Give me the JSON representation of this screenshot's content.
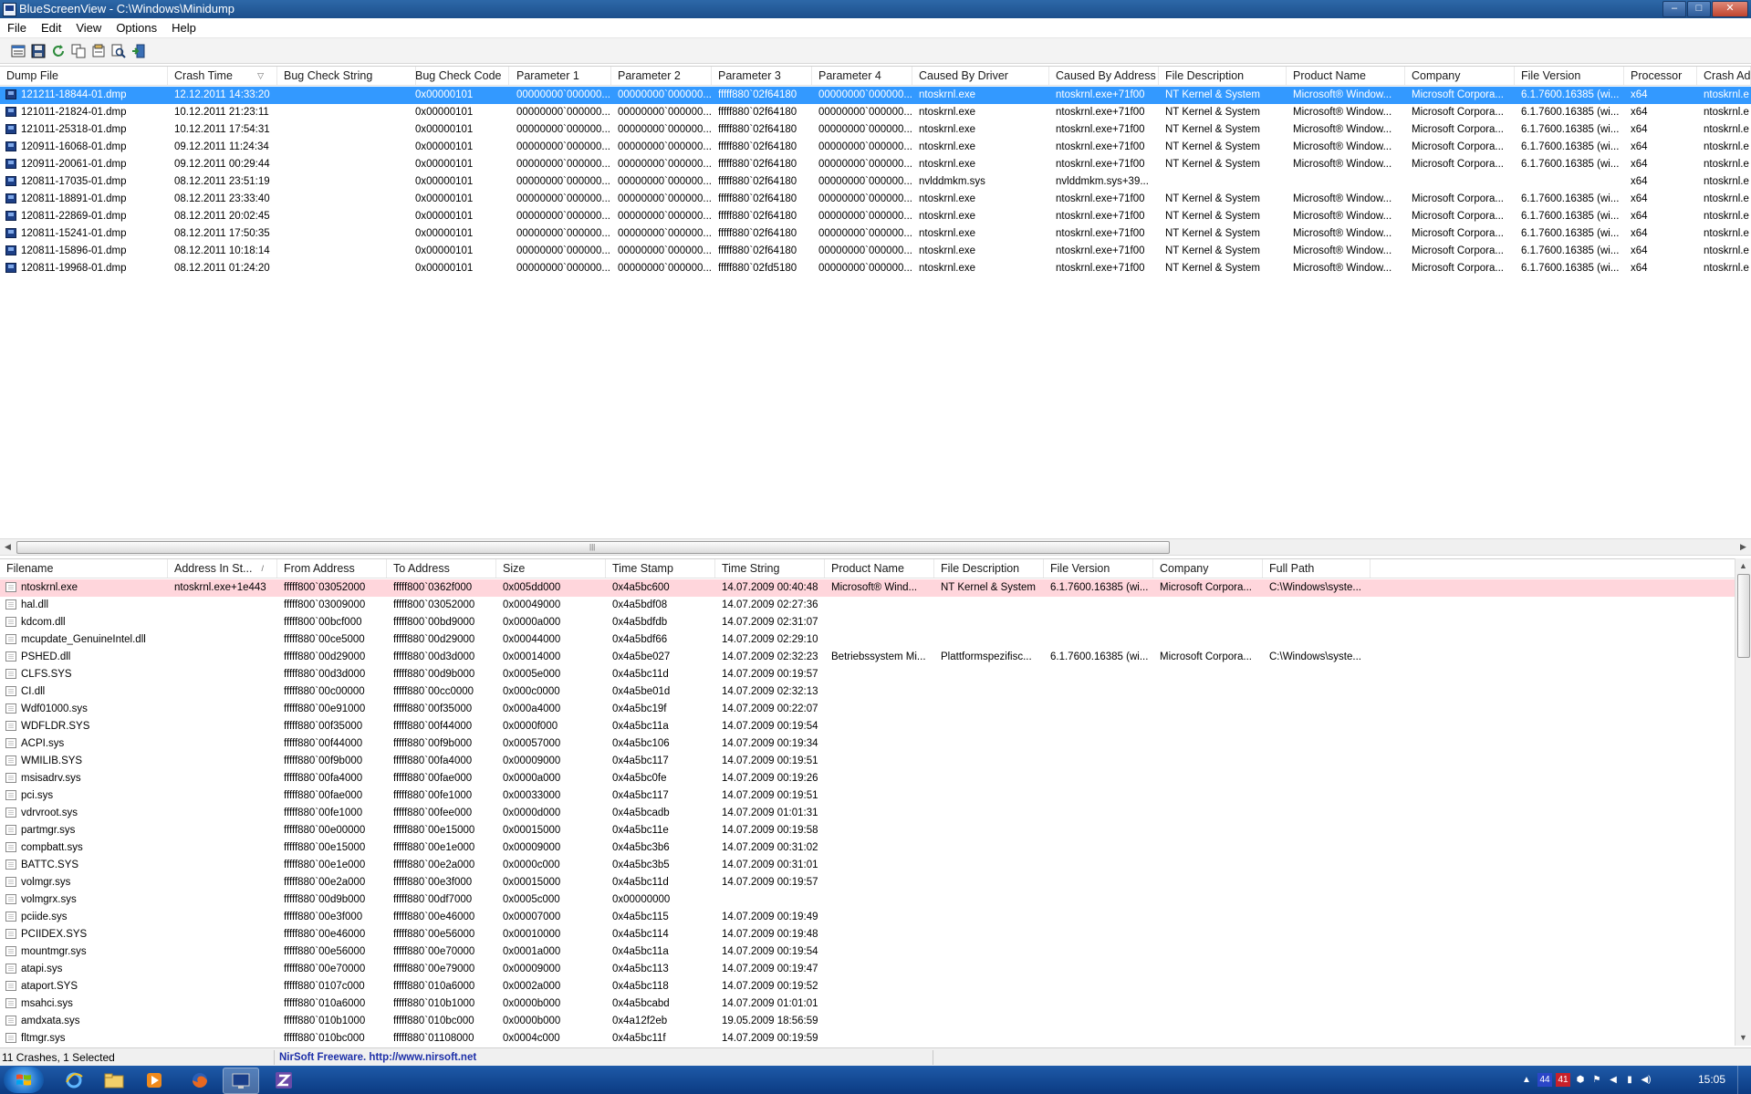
{
  "window": {
    "title": "BlueScreenView  -  C:\\Windows\\Minidump",
    "minimize_label": "–",
    "maximize_label": "□",
    "close_label": "✕"
  },
  "menu": [
    "File",
    "Edit",
    "View",
    "Options",
    "Help"
  ],
  "toolbar": {
    "icons": [
      "properties-icon",
      "save-icon",
      "refresh-icon",
      "copy-icon",
      "html-report-icon",
      "find-icon",
      "exit-icon"
    ]
  },
  "crash_list": {
    "columns": [
      "Dump File",
      "Crash Time",
      "Bug Check String",
      "Bug Check Code",
      "Parameter 1",
      "Parameter 2",
      "Parameter 3",
      "Parameter 4",
      "Caused By Driver",
      "Caused By Address",
      "File Description",
      "Product Name",
      "Company",
      "File Version",
      "Processor",
      "Crash Add"
    ],
    "sorted_column": "Crash Time",
    "sort_arrow": "▽",
    "selected_index": 0,
    "rows": [
      [
        "121211-18844-01.dmp",
        "12.12.2011 14:33:20",
        "",
        "0x00000101",
        "00000000`000000...",
        "00000000`000000...",
        "fffff880`02f64180",
        "00000000`000000...",
        "ntoskrnl.exe",
        "ntoskrnl.exe+71f00",
        "NT Kernel & System",
        "Microsoft® Window...",
        "Microsoft Corpora...",
        "6.1.7600.16385 (wi...",
        "x64",
        "ntoskrnl.e"
      ],
      [
        "121011-21824-01.dmp",
        "10.12.2011 21:23:11",
        "",
        "0x00000101",
        "00000000`000000...",
        "00000000`000000...",
        "fffff880`02f64180",
        "00000000`000000...",
        "ntoskrnl.exe",
        "ntoskrnl.exe+71f00",
        "NT Kernel & System",
        "Microsoft® Window...",
        "Microsoft Corpora...",
        "6.1.7600.16385 (wi...",
        "x64",
        "ntoskrnl.e"
      ],
      [
        "121011-25318-01.dmp",
        "10.12.2011 17:54:31",
        "",
        "0x00000101",
        "00000000`000000...",
        "00000000`000000...",
        "fffff880`02f64180",
        "00000000`000000...",
        "ntoskrnl.exe",
        "ntoskrnl.exe+71f00",
        "NT Kernel & System",
        "Microsoft® Window...",
        "Microsoft Corpora...",
        "6.1.7600.16385 (wi...",
        "x64",
        "ntoskrnl.e"
      ],
      [
        "120911-16068-01.dmp",
        "09.12.2011 11:24:34",
        "",
        "0x00000101",
        "00000000`000000...",
        "00000000`000000...",
        "fffff880`02f64180",
        "00000000`000000...",
        "ntoskrnl.exe",
        "ntoskrnl.exe+71f00",
        "NT Kernel & System",
        "Microsoft® Window...",
        "Microsoft Corpora...",
        "6.1.7600.16385 (wi...",
        "x64",
        "ntoskrnl.e"
      ],
      [
        "120911-20061-01.dmp",
        "09.12.2011 00:29:44",
        "",
        "0x00000101",
        "00000000`000000...",
        "00000000`000000...",
        "fffff880`02f64180",
        "00000000`000000...",
        "ntoskrnl.exe",
        "ntoskrnl.exe+71f00",
        "NT Kernel & System",
        "Microsoft® Window...",
        "Microsoft Corpora...",
        "6.1.7600.16385 (wi...",
        "x64",
        "ntoskrnl.e"
      ],
      [
        "120811-17035-01.dmp",
        "08.12.2011 23:51:19",
        "",
        "0x00000101",
        "00000000`000000...",
        "00000000`000000...",
        "fffff880`02f64180",
        "00000000`000000...",
        "nvlddmkm.sys",
        "nvlddmkm.sys+39...",
        "",
        "",
        "",
        "",
        "x64",
        "ntoskrnl.e"
      ],
      [
        "120811-18891-01.dmp",
        "08.12.2011 23:33:40",
        "",
        "0x00000101",
        "00000000`000000...",
        "00000000`000000...",
        "fffff880`02f64180",
        "00000000`000000...",
        "ntoskrnl.exe",
        "ntoskrnl.exe+71f00",
        "NT Kernel & System",
        "Microsoft® Window...",
        "Microsoft Corpora...",
        "6.1.7600.16385 (wi...",
        "x64",
        "ntoskrnl.e"
      ],
      [
        "120811-22869-01.dmp",
        "08.12.2011 20:02:45",
        "",
        "0x00000101",
        "00000000`000000...",
        "00000000`000000...",
        "fffff880`02f64180",
        "00000000`000000...",
        "ntoskrnl.exe",
        "ntoskrnl.exe+71f00",
        "NT Kernel & System",
        "Microsoft® Window...",
        "Microsoft Corpora...",
        "6.1.7600.16385 (wi...",
        "x64",
        "ntoskrnl.e"
      ],
      [
        "120811-15241-01.dmp",
        "08.12.2011 17:50:35",
        "",
        "0x00000101",
        "00000000`000000...",
        "00000000`000000...",
        "fffff880`02f64180",
        "00000000`000000...",
        "ntoskrnl.exe",
        "ntoskrnl.exe+71f00",
        "NT Kernel & System",
        "Microsoft® Window...",
        "Microsoft Corpora...",
        "6.1.7600.16385 (wi...",
        "x64",
        "ntoskrnl.e"
      ],
      [
        "120811-15896-01.dmp",
        "08.12.2011 10:18:14",
        "",
        "0x00000101",
        "00000000`000000...",
        "00000000`000000...",
        "fffff880`02f64180",
        "00000000`000000...",
        "ntoskrnl.exe",
        "ntoskrnl.exe+71f00",
        "NT Kernel & System",
        "Microsoft® Window...",
        "Microsoft Corpora...",
        "6.1.7600.16385 (wi...",
        "x64",
        "ntoskrnl.e"
      ],
      [
        "120811-19968-01.dmp",
        "08.12.2011 01:24:20",
        "",
        "0x00000101",
        "00000000`000000...",
        "00000000`000000...",
        "fffff880`02fd5180",
        "00000000`000000...",
        "ntoskrnl.exe",
        "ntoskrnl.exe+71f00",
        "NT Kernel & System",
        "Microsoft® Window...",
        "Microsoft Corpora...",
        "6.1.7600.16385 (wi...",
        "x64",
        "ntoskrnl.e"
      ]
    ]
  },
  "driver_list": {
    "columns": [
      "Filename",
      "Address In St...",
      "From Address",
      "To Address",
      "Size",
      "Time Stamp",
      "Time String",
      "Product Name",
      "File Description",
      "File Version",
      "Company",
      "Full Path"
    ],
    "sorted_column": "Address In St...",
    "sort_arrow": "/",
    "highlighted_index": 0,
    "rows": [
      [
        "ntoskrnl.exe",
        "ntoskrnl.exe+1e443",
        "fffff800`03052000",
        "fffff800`0362f000",
        "0x005dd000",
        "0x4a5bc600",
        "14.07.2009 00:40:48",
        "Microsoft® Wind...",
        "NT Kernel & System",
        "6.1.7600.16385 (wi...",
        "Microsoft Corpora...",
        "C:\\Windows\\syste..."
      ],
      [
        "hal.dll",
        "",
        "fffff800`03009000",
        "fffff800`03052000",
        "0x00049000",
        "0x4a5bdf08",
        "14.07.2009 02:27:36",
        "",
        "",
        "",
        "",
        ""
      ],
      [
        "kdcom.dll",
        "",
        "fffff800`00bcf000",
        "fffff800`00bd9000",
        "0x0000a000",
        "0x4a5bdfdb",
        "14.07.2009 02:31:07",
        "",
        "",
        "",
        "",
        ""
      ],
      [
        "mcupdate_GenuineIntel.dll",
        "",
        "fffff880`00ce5000",
        "fffff880`00d29000",
        "0x00044000",
        "0x4a5bdf66",
        "14.07.2009 02:29:10",
        "",
        "",
        "",
        "",
        ""
      ],
      [
        "PSHED.dll",
        "",
        "fffff880`00d29000",
        "fffff880`00d3d000",
        "0x00014000",
        "0x4a5be027",
        "14.07.2009 02:32:23",
        "Betriebssystem Mi...",
        "Plattformspezifisc...",
        "6.1.7600.16385 (wi...",
        "Microsoft Corpora...",
        "C:\\Windows\\syste..."
      ],
      [
        "CLFS.SYS",
        "",
        "fffff880`00d3d000",
        "fffff880`00d9b000",
        "0x0005e000",
        "0x4a5bc11d",
        "14.07.2009 00:19:57",
        "",
        "",
        "",
        "",
        ""
      ],
      [
        "CI.dll",
        "",
        "fffff880`00c00000",
        "fffff880`00cc0000",
        "0x000c0000",
        "0x4a5be01d",
        "14.07.2009 02:32:13",
        "",
        "",
        "",
        "",
        ""
      ],
      [
        "Wdf01000.sys",
        "",
        "fffff880`00e91000",
        "fffff880`00f35000",
        "0x000a4000",
        "0x4a5bc19f",
        "14.07.2009 00:22:07",
        "",
        "",
        "",
        "",
        ""
      ],
      [
        "WDFLDR.SYS",
        "",
        "fffff880`00f35000",
        "fffff880`00f44000",
        "0x0000f000",
        "0x4a5bc11a",
        "14.07.2009 00:19:54",
        "",
        "",
        "",
        "",
        ""
      ],
      [
        "ACPI.sys",
        "",
        "fffff880`00f44000",
        "fffff880`00f9b000",
        "0x00057000",
        "0x4a5bc106",
        "14.07.2009 00:19:34",
        "",
        "",
        "",
        "",
        ""
      ],
      [
        "WMILIB.SYS",
        "",
        "fffff880`00f9b000",
        "fffff880`00fa4000",
        "0x00009000",
        "0x4a5bc117",
        "14.07.2009 00:19:51",
        "",
        "",
        "",
        "",
        ""
      ],
      [
        "msisadrv.sys",
        "",
        "fffff880`00fa4000",
        "fffff880`00fae000",
        "0x0000a000",
        "0x4a5bc0fe",
        "14.07.2009 00:19:26",
        "",
        "",
        "",
        "",
        ""
      ],
      [
        "pci.sys",
        "",
        "fffff880`00fae000",
        "fffff880`00fe1000",
        "0x00033000",
        "0x4a5bc117",
        "14.07.2009 00:19:51",
        "",
        "",
        "",
        "",
        ""
      ],
      [
        "vdrvroot.sys",
        "",
        "fffff880`00fe1000",
        "fffff880`00fee000",
        "0x0000d000",
        "0x4a5bcadb",
        "14.07.2009 01:01:31",
        "",
        "",
        "",
        "",
        ""
      ],
      [
        "partmgr.sys",
        "",
        "fffff880`00e00000",
        "fffff880`00e15000",
        "0x00015000",
        "0x4a5bc11e",
        "14.07.2009 00:19:58",
        "",
        "",
        "",
        "",
        ""
      ],
      [
        "compbatt.sys",
        "",
        "fffff880`00e15000",
        "fffff880`00e1e000",
        "0x00009000",
        "0x4a5bc3b6",
        "14.07.2009 00:31:02",
        "",
        "",
        "",
        "",
        ""
      ],
      [
        "BATTC.SYS",
        "",
        "fffff880`00e1e000",
        "fffff880`00e2a000",
        "0x0000c000",
        "0x4a5bc3b5",
        "14.07.2009 00:31:01",
        "",
        "",
        "",
        "",
        ""
      ],
      [
        "volmgr.sys",
        "",
        "fffff880`00e2a000",
        "fffff880`00e3f000",
        "0x00015000",
        "0x4a5bc11d",
        "14.07.2009 00:19:57",
        "",
        "",
        "",
        "",
        ""
      ],
      [
        "volmgrx.sys",
        "",
        "fffff880`00d9b000",
        "fffff880`00df7000",
        "0x0005c000",
        "0x00000000",
        "",
        "",
        "",
        "",
        "",
        ""
      ],
      [
        "pciide.sys",
        "",
        "fffff880`00e3f000",
        "fffff880`00e46000",
        "0x00007000",
        "0x4a5bc115",
        "14.07.2009 00:19:49",
        "",
        "",
        "",
        "",
        ""
      ],
      [
        "PCIIDEX.SYS",
        "",
        "fffff880`00e46000",
        "fffff880`00e56000",
        "0x00010000",
        "0x4a5bc114",
        "14.07.2009 00:19:48",
        "",
        "",
        "",
        "",
        ""
      ],
      [
        "mountmgr.sys",
        "",
        "fffff880`00e56000",
        "fffff880`00e70000",
        "0x0001a000",
        "0x4a5bc11a",
        "14.07.2009 00:19:54",
        "",
        "",
        "",
        "",
        ""
      ],
      [
        "atapi.sys",
        "",
        "fffff880`00e70000",
        "fffff880`00e79000",
        "0x00009000",
        "0x4a5bc113",
        "14.07.2009 00:19:47",
        "",
        "",
        "",
        "",
        ""
      ],
      [
        "ataport.SYS",
        "",
        "fffff880`0107c000",
        "fffff880`010a6000",
        "0x0002a000",
        "0x4a5bc118",
        "14.07.2009 00:19:52",
        "",
        "",
        "",
        "",
        ""
      ],
      [
        "msahci.sys",
        "",
        "fffff880`010a6000",
        "fffff880`010b1000",
        "0x0000b000",
        "0x4a5bcabd",
        "14.07.2009 01:01:01",
        "",
        "",
        "",
        "",
        ""
      ],
      [
        "amdxata.sys",
        "",
        "fffff880`010b1000",
        "fffff880`010bc000",
        "0x0000b000",
        "0x4a12f2eb",
        "19.05.2009 18:56:59",
        "",
        "",
        "",
        "",
        ""
      ],
      [
        "fltmgr.sys",
        "",
        "fffff880`010bc000",
        "fffff880`01108000",
        "0x0004c000",
        "0x4a5bc11f",
        "14.07.2009 00:19:59",
        "",
        "",
        "",
        "",
        ""
      ]
    ]
  },
  "status": {
    "count_text": "11 Crashes, 1 Selected",
    "freeware_text": "NirSoft Freeware.  http://www.nirsoft.net"
  },
  "taskbar": {
    "apps": [
      "ie-icon",
      "explorer-icon",
      "media-player-icon",
      "firefox-icon",
      "bluescreenview-icon",
      "zonealarm-icon"
    ],
    "tray_badge_blue": "44",
    "tray_badge_red": "41",
    "clock": "15:05"
  },
  "colors": {
    "selection": "#3399ff",
    "highlight_row": "#ffd6dc",
    "taskbar": "#0b3b82",
    "title_bar": "#1c4f8c",
    "status_link": "#1d2fa8"
  }
}
